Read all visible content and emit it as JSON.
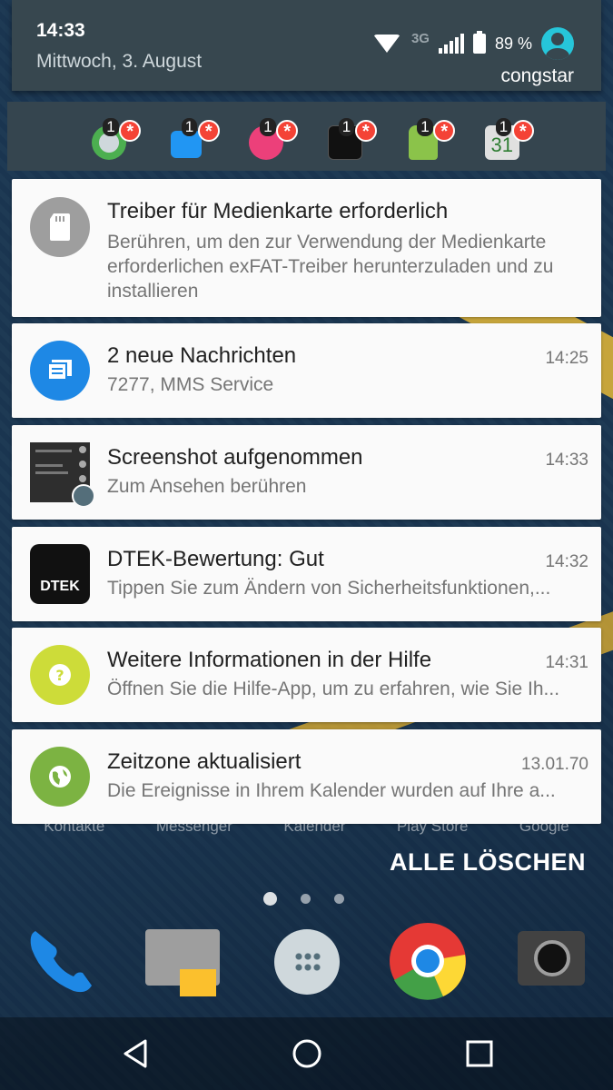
{
  "status": {
    "time": "14:33",
    "date": "Mittwoch, 3. August",
    "network": "3G",
    "battery": "89 %",
    "carrier": "congstar"
  },
  "app_icons": [
    {
      "name": "sound-profile-icon",
      "count": "1",
      "color": "#4caf50"
    },
    {
      "name": "messages-icon",
      "count": "1",
      "color": "#2196f3"
    },
    {
      "name": "hub-icon",
      "count": "1",
      "color": "#ec407a"
    },
    {
      "name": "dtek-icon",
      "count": "1",
      "color": "#111111"
    },
    {
      "name": "android-icon",
      "count": "1",
      "color": "#8bc34a"
    },
    {
      "name": "calendar-icon",
      "count": "1",
      "color": "#e0e0e0",
      "day": "31"
    }
  ],
  "notifications": [
    {
      "title": "Treiber für Medienkarte erforderlich",
      "time": "",
      "body": "Berühren, um den zur Verwendung der Medienkarte erforderlichen exFAT-Treiber herunterzuladen und zu installieren",
      "icon": "sd-card-icon",
      "icon_color": "#9e9e9e"
    },
    {
      "title": "2 neue Nachrichten",
      "time": "14:25",
      "body": "7277, MMS Service",
      "icon": "message-icon",
      "icon_color": "#1e88e5"
    },
    {
      "title": "Screenshot aufgenommen",
      "time": "14:33",
      "body": "Zum Ansehen berühren",
      "icon": "screenshot-thumbnail"
    },
    {
      "title": "DTEK-Bewertung: Gut",
      "time": "14:32",
      "body": "Tippen Sie zum Ändern von Sicherheitsfunktionen,...",
      "icon": "dtek-app-icon",
      "icon_text": "DTEK"
    },
    {
      "title": "Weitere Informationen in der Hilfe",
      "time": "14:31",
      "body": "Öffnen Sie die Hilfe-App, um zu erfahren, wie Sie Ih...",
      "icon": "help-icon",
      "icon_color": "#cddc39"
    },
    {
      "title": "Zeitzone aktualisiert",
      "time": "13.01.70",
      "body": "Die Ereignisse in Ihrem Kalender wurden auf Ihre a...",
      "icon": "globe-icon",
      "icon_color": "#7cb342"
    }
  ],
  "clear_all": "ALLE LÖSCHEN",
  "dock_labels": [
    "Kontakte",
    "Messenger",
    "Kalender",
    "Play Store",
    "Google"
  ]
}
